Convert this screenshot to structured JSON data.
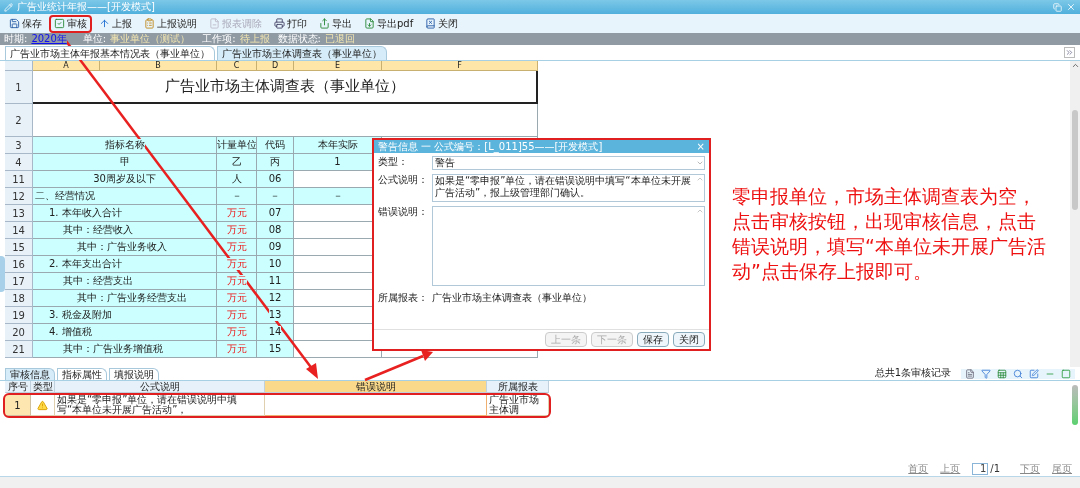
{
  "window": {
    "title": "广告业统计年报——[开发模式]"
  },
  "toolbar": [
    {
      "label": "保存",
      "kind": "save",
      "disabled": false,
      "highlighted": false
    },
    {
      "label": "审核",
      "kind": "check",
      "disabled": false,
      "highlighted": true
    },
    {
      "label": "上报",
      "kind": "upload",
      "disabled": false,
      "highlighted": false
    },
    {
      "label": "上报说明",
      "kind": "note",
      "disabled": false,
      "highlighted": false
    },
    {
      "label": "报表调除",
      "kind": "remove",
      "disabled": true,
      "highlighted": false
    },
    {
      "label": "打印",
      "kind": "print",
      "disabled": false,
      "highlighted": false
    },
    {
      "label": "导出",
      "kind": "export",
      "disabled": false,
      "highlighted": false
    },
    {
      "label": "导出pdf",
      "kind": "pdf",
      "disabled": false,
      "highlighted": false
    },
    {
      "label": "关闭",
      "kind": "close",
      "disabled": false,
      "highlighted": false
    }
  ],
  "info_bar": {
    "period_label": "时期:",
    "period": "2020年",
    "unit_label": "单位:",
    "unit": "事业单位（测试）",
    "work_label": "工作项:",
    "work": "待上报",
    "status_label": "数据状态:",
    "status": "已退回"
  },
  "sheet_tabs": [
    {
      "label": "广告业市场主体年报基本情况表（事业单位）",
      "selected": false
    },
    {
      "label": "广告业市场主体调查表（事业单位）",
      "selected": true
    }
  ],
  "sheet": {
    "columns": [
      "A",
      "B",
      "C",
      "D",
      "E",
      "F"
    ],
    "title_row": "1",
    "title": "广告业市场主体调查表（事业单位）",
    "blank_row": "2",
    "header": {
      "row": "3",
      "name": "指标名称",
      "unit": "计量单位",
      "code": "代码",
      "value": "本年实际"
    },
    "rows": [
      {
        "row": "4",
        "kind": "center",
        "name": "甲",
        "unit": "乙",
        "code": "丙",
        "value": "1",
        "unit_red": false
      },
      {
        "row": "11",
        "kind": "center",
        "name": "30周岁及以下",
        "unit": "人",
        "code": "06",
        "unit_red": false
      },
      {
        "row": "12",
        "kind": "item",
        "name": "二、经营情况",
        "unit": "－",
        "code": "－",
        "value": "－",
        "unit_red": false,
        "children": [
          {
            "row": "13",
            "kind": "item",
            "name": "1. 本年收入合计",
            "unit": "万元",
            "code": "07",
            "unit_red": true,
            "children": [
              {
                "row": "14",
                "kind": "item",
                "name": "其中：经营收入",
                "unit": "万元",
                "code": "08",
                "unit_red": true,
                "children": [
                  {
                    "row": "15",
                    "kind": "item",
                    "name": "其中：广告业务收入",
                    "unit": "万元",
                    "code": "09",
                    "unit_red": true
                  }
                ]
              }
            ]
          },
          {
            "row": "16",
            "kind": "item",
            "name": "2. 本年支出合计",
            "unit": "万元",
            "code": "10",
            "unit_red": true,
            "children": [
              {
                "row": "17",
                "kind": "item",
                "name": "其中：经营支出",
                "unit": "万元",
                "code": "11",
                "unit_red": true,
                "children": [
                  {
                    "row": "18",
                    "kind": "item",
                    "name": "其中：广告业务经营支出",
                    "unit": "万元",
                    "code": "12",
                    "unit_red": true
                  }
                ]
              }
            ]
          },
          {
            "row": "19",
            "kind": "item",
            "name": "3. 税金及附加",
            "unit": "万元",
            "code": "13",
            "unit_red": true
          },
          {
            "row": "20",
            "kind": "item",
            "name": "4. 增值税",
            "unit": "万元",
            "code": "14",
            "unit_red": true,
            "children": [
              {
                "row": "21",
                "kind": "item",
                "name": "其中：广告业务增值税",
                "unit": "万元",
                "code": "15",
                "unit_red": true
              }
            ]
          }
        ]
      }
    ]
  },
  "dialog": {
    "title": "警告信息 一 公式编号：[L_011]55——[开发模式]",
    "close": "×",
    "fields": [
      {
        "label": "类型：",
        "kind": "select",
        "value": "警告"
      },
      {
        "label": "公式说明：",
        "kind": "textarea",
        "value": "如果是“零申报”单位，请在错误说明中填写“本单位未开展广告活动”，报上级管理部门确认。"
      },
      {
        "label": "错误说明：",
        "kind": "bigarea"
      }
    ],
    "report_label": "所属报表：",
    "report": "广告业市场主体调查表（事业单位）",
    "buttons": [
      {
        "label": "上一条",
        "disabled": true
      },
      {
        "label": "下一条",
        "disabled": true
      },
      {
        "label": "保存",
        "disabled": false
      },
      {
        "label": "关闭",
        "disabled": false
      }
    ]
  },
  "annotation": "零申报单位，市场主体调查表为空，点击审核按钮，出现审核信息，点击错误说明，填写“本单位未开展广告活动”点击保存上报即可。",
  "bottom_panel": {
    "tabs": [
      {
        "label": "审核信息",
        "selected": true
      },
      {
        "label": "指标属性",
        "selected": false
      },
      {
        "label": "填报说明",
        "selected": false
      }
    ],
    "record_count": "总共1条审核记录",
    "tools": [
      {
        "kind": "doc"
      },
      {
        "kind": "filter"
      },
      {
        "kind": "excel"
      },
      {
        "kind": "zoom"
      },
      {
        "kind": "edit"
      },
      {
        "kind": "minimize"
      },
      {
        "kind": "maximize"
      }
    ],
    "columns": [
      {
        "label": "序号",
        "selected": false
      },
      {
        "label": "类型",
        "selected": false
      },
      {
        "label": "公式说明",
        "selected": false
      },
      {
        "label": "错误说明",
        "selected": true
      },
      {
        "label": "所属报表",
        "selected": false
      }
    ],
    "rows": [
      {
        "index": "1",
        "kind": "warning",
        "highlighted": true,
        "formula": "如果是“零申报”单位，请在错误说明中填写“本单位未开展广告活动”，",
        "report": "广告业市场主体调"
      }
    ],
    "pager": {
      "first": "首页",
      "prev": "上页",
      "page": "1",
      "total": "/1",
      "next": "下页",
      "last": "尾页"
    }
  }
}
